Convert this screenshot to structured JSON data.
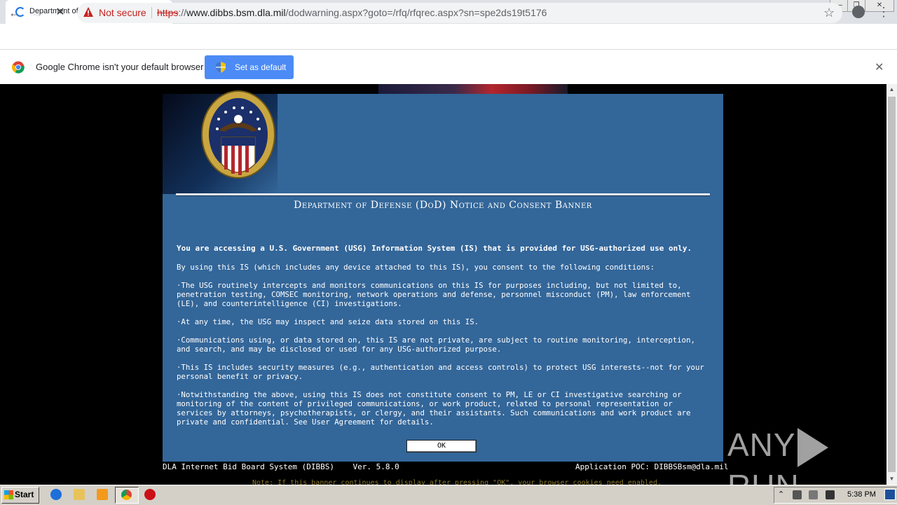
{
  "browser": {
    "tab_title": "Department of Defense (DoD) Warning",
    "tab_close": "✕",
    "new_tab": "+",
    "window_controls": {
      "minimize": "—",
      "maximize": "❐",
      "close": "✕"
    },
    "nav": {
      "back": "←",
      "forward": "→",
      "stop": "✕"
    },
    "security_label": "Not secure",
    "url": {
      "scheme": "https",
      "separator": "://",
      "host": "www.dibbs.bsm.dla.mil",
      "rest": "/dodwarning.aspx?goto=/rfq/rfqrec.aspx?sn=spe2ds19t5176"
    },
    "star": "☆",
    "menu": "⋮"
  },
  "infobar": {
    "message": "Google Chrome isn't your default browser",
    "button_label": "Set as default",
    "close": "✕"
  },
  "page": {
    "banner_title": "Department of Defense (DoD) Notice and Consent Banner",
    "lead": "You are accessing a U.S. Government (USG) Information System (IS) that is provided for USG-authorized use only.",
    "intro": "By using this IS (which includes any device attached to this IS), you consent to the following conditions:",
    "conditions": [
      "·The USG routinely intercepts and monitors communications on this IS for purposes including, but not limited to, penetration testing, COMSEC monitoring, network operations and defense, personnel misconduct (PM), law enforcement (LE), and counterintelligence (CI) investigations.",
      "·At any time, the USG may inspect and seize data stored on this IS.",
      "·Communications using, or data stored on, this IS are not private, are subject to routine monitoring, interception, and search, and may be disclosed or used for any USG-authorized purpose.",
      "·This IS includes security measures (e.g., authentication and access controls) to protect USG interests--not for your personal benefit or privacy.",
      "·Notwithstanding the above, using this IS does not constitute consent to PM, LE or CI investigative searching or monitoring of the content of privileged communications, or work product, related to personal representation or services by attorneys, psychotherapists, or clergy, and their assistants.  Such communications and work product are private and confidential.  See User Agreement for details."
    ],
    "ok_label": "OK",
    "footer_left": "DLA Internet Bid Board System (DIBBS)    Ver. 5.8.0",
    "footer_right": "Application POC: DIBBSBsm@dla.mil",
    "note": "Note: If this banner continues to display after pressing \"OK\", your browser cookies need enabled."
  },
  "watermark": {
    "left": "ANY",
    "right": "RUN"
  },
  "taskbar": {
    "start_label": "Start",
    "clock": "5:38 PM"
  },
  "colors": {
    "panel": "#336699",
    "not_secure": "#c5221f",
    "infobar_button": "#4c8bf5"
  }
}
